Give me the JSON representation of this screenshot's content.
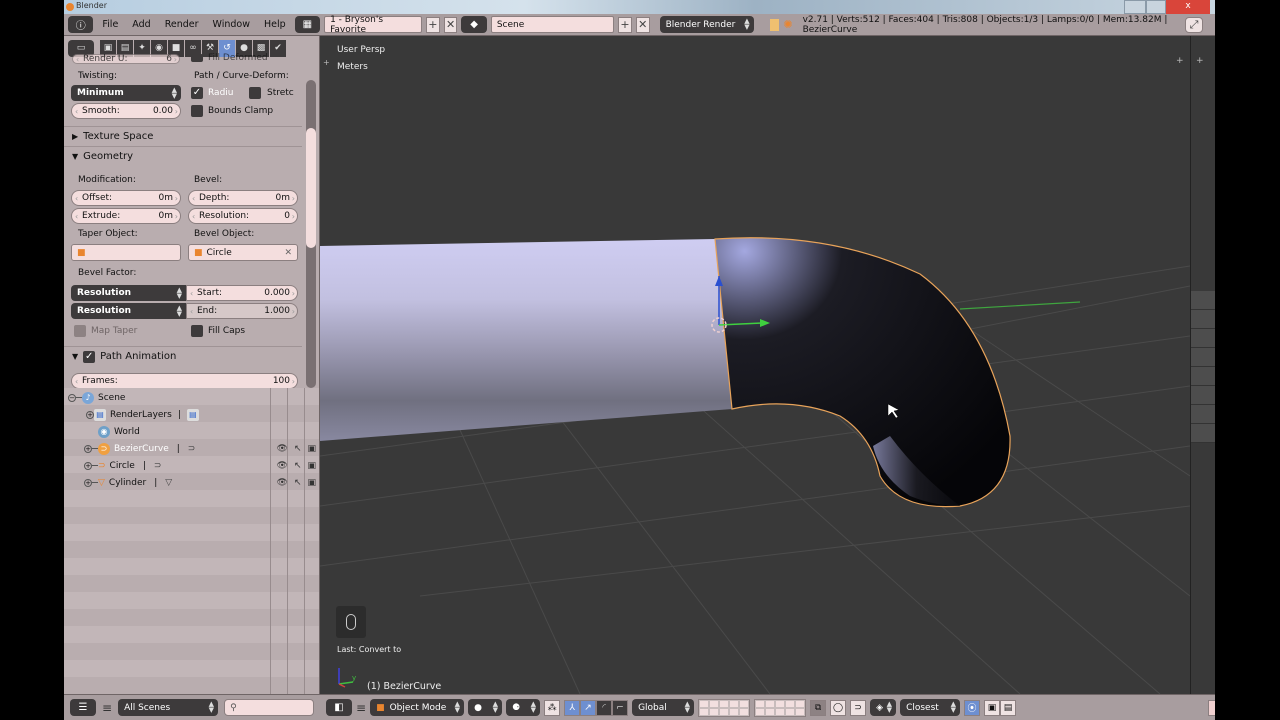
{
  "window": {
    "title": "Blender",
    "close_label": "x"
  },
  "header": {
    "menus": [
      "File",
      "Add",
      "Render",
      "Window",
      "Help"
    ],
    "screen_layout": "1 - Bryson's Favorite",
    "scene": "Scene",
    "render_engine": "Blender Render",
    "stats": "v2.71 | Verts:512 | Faces:404 | Tris:808 | Objects:1/3 | Lamps:0/0 | Mem:13.82M | BezierCurve"
  },
  "properties": {
    "cut_top_label": "Render U:",
    "cut_top_value": "6",
    "fill_deformed": "Fill Deformed",
    "twisting_label": "Twisting:",
    "twisting_value": "Minimum",
    "smooth_label": "Smooth:",
    "smooth_value": "0.00",
    "path_curve_deform_label": "Path / Curve-Deform:",
    "radius_label": "Radiu",
    "radius_checked": true,
    "stretch_label": "Stretc",
    "stretch_checked": false,
    "bounds_clamp_label": "Bounds Clamp",
    "bounds_clamp_checked": false,
    "sections": {
      "texture_space": "Texture Space",
      "geometry": "Geometry",
      "path_animation": "Path Animation"
    },
    "geometry": {
      "modification_label": "Modification:",
      "bevel_label": "Bevel:",
      "offset_label": "Offset:",
      "offset_value": "0m",
      "extrude_label": "Extrude:",
      "extrude_value": "0m",
      "depth_label": "Depth:",
      "depth_value": "0m",
      "resolution_label": "Resolution:",
      "resolution_value": "0",
      "taper_object_label": "Taper Object:",
      "taper_object_value": "",
      "bevel_object_label": "Bevel Object:",
      "bevel_object_value": "Circle",
      "bevel_factor_label": "Bevel Factor:",
      "start_mode": "Resolution",
      "start_label": "Start:",
      "start_value": "0.000",
      "end_mode": "Resolution",
      "end_label": "End:",
      "end_value": "1.000",
      "map_taper_label": "Map Taper",
      "fill_caps_label": "Fill Caps"
    },
    "path_animation": {
      "enabled": true,
      "frames_label": "Frames:",
      "frames_value": "100"
    }
  },
  "outliner": {
    "items": [
      {
        "name": "Scene",
        "level": 0
      },
      {
        "name": "RenderLayers",
        "level": 1
      },
      {
        "name": "World",
        "level": 1
      },
      {
        "name": "BezierCurve",
        "level": 1,
        "selected": true
      },
      {
        "name": "Circle",
        "level": 1
      },
      {
        "name": "Cylinder",
        "level": 1
      }
    ],
    "filter": "All Scenes",
    "search_placeholder": ""
  },
  "viewport": {
    "view_name": "User Persp",
    "units": "Meters",
    "last_operator": "Last: Convert to",
    "active_object": "(1) BezierCurve",
    "mode": "Object Mode",
    "orientation": "Global",
    "snap_target": "Closest"
  },
  "colors": {
    "selection_outline": "#e8a35a",
    "active_tab": "#6e8fd0",
    "panel_bg": "#b9adaf",
    "viewport_bg": "#393939"
  }
}
